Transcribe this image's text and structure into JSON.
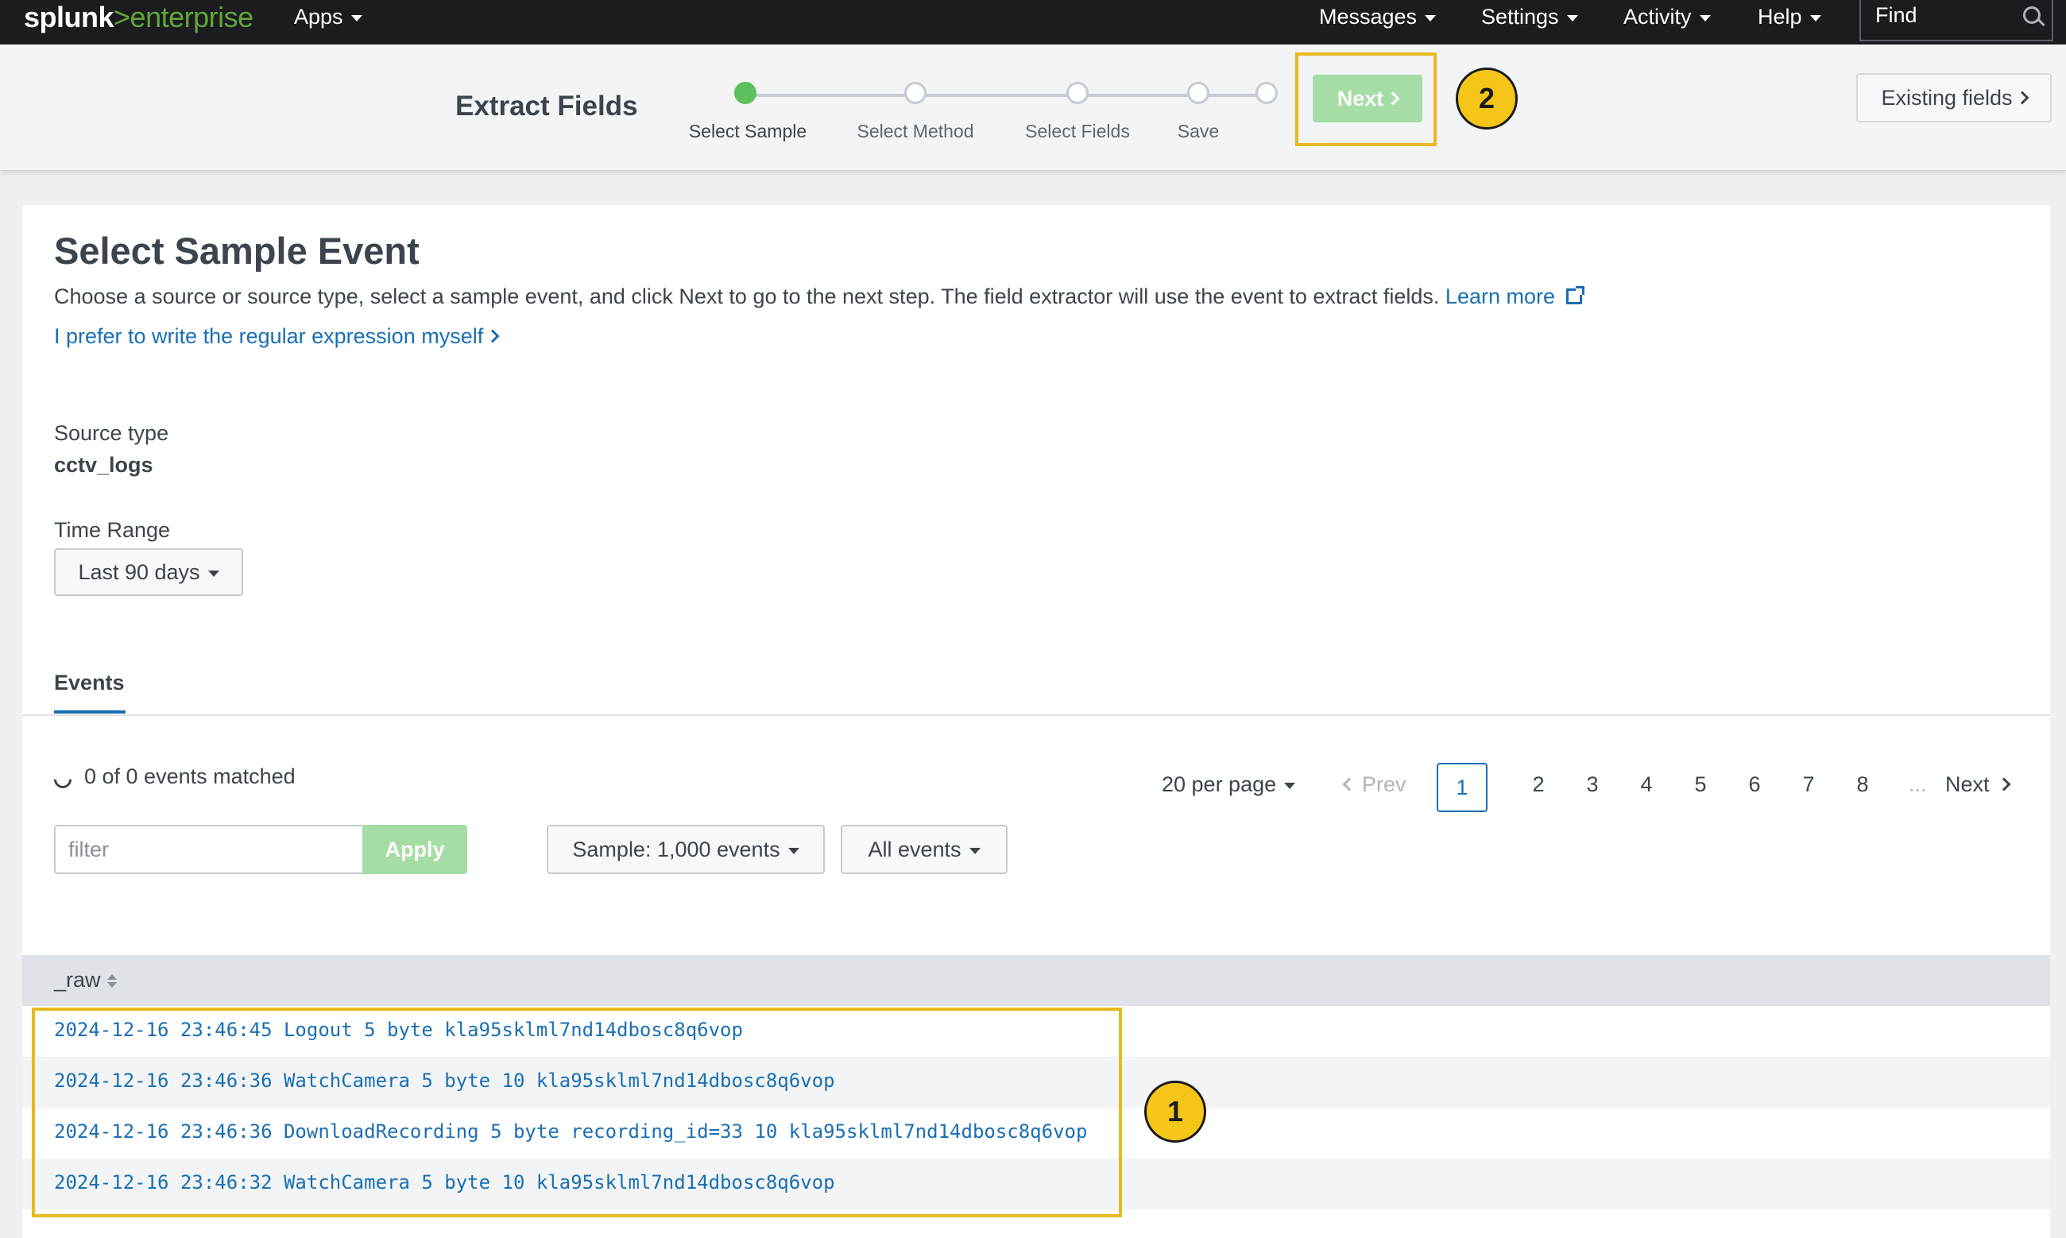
{
  "topnav": {
    "logo_main": "splunk",
    "logo_sep": ">",
    "logo_product": "enterprise",
    "apps": "Apps",
    "messages": "Messages",
    "settings": "Settings",
    "activity": "Activity",
    "help": "Help",
    "find": "Find"
  },
  "wizard": {
    "title": "Extract Fields",
    "steps": [
      {
        "label": "Select Sample",
        "active": true
      },
      {
        "label": "Select Method",
        "active": false
      },
      {
        "label": "Select Fields",
        "active": false
      },
      {
        "label": "Save",
        "active": false
      },
      {
        "label": "",
        "active": false
      }
    ],
    "next_label": "Next",
    "existing_fields_label": "Existing fields"
  },
  "annotations": {
    "badge1": "1",
    "badge2": "2",
    "highlight_color": "#e8b920"
  },
  "main": {
    "title": "Select Sample Event",
    "description": "Choose a source or source type, select a sample event, and click Next to go to the next step. The field extractor will use the event to extract fields.",
    "learn_more": "Learn more",
    "regex_link": "I prefer to write the regular expression myself",
    "source_type_label": "Source type",
    "source_type_value": "cctv_logs",
    "time_range_label": "Time Range",
    "time_range_value": "Last 90 days",
    "tab_events": "Events",
    "matched_text": "0 of 0 events matched",
    "filter_placeholder": "filter",
    "apply_label": "Apply",
    "sample_label": "Sample: 1,000 events",
    "all_events_label": "All events",
    "pagination": {
      "per_page": "20 per page",
      "prev": "Prev",
      "pages": [
        "1",
        "2",
        "3",
        "4",
        "5",
        "6",
        "7",
        "8"
      ],
      "current": "1",
      "ellipsis": "...",
      "next": "Next"
    },
    "table": {
      "column": "_raw",
      "rows": [
        "2024-12-16 23:46:45 Logout 5 byte kla95sklml7nd14dbosc8q6vop",
        "2024-12-16 23:46:36 WatchCamera 5 byte 10 kla95sklml7nd14dbosc8q6vop",
        "2024-12-16 23:46:36 DownloadRecording 5 byte recording_id=33 10 kla95sklml7nd14dbosc8q6vop",
        "2024-12-16 23:46:32 WatchCamera 5 byte 10 kla95sklml7nd14dbosc8q6vop"
      ]
    }
  },
  "colors": {
    "accent": "#1a6fb3",
    "success": "#5cc05c",
    "button_disabled": "#a6dca6",
    "topbar": "#1a1c20"
  }
}
